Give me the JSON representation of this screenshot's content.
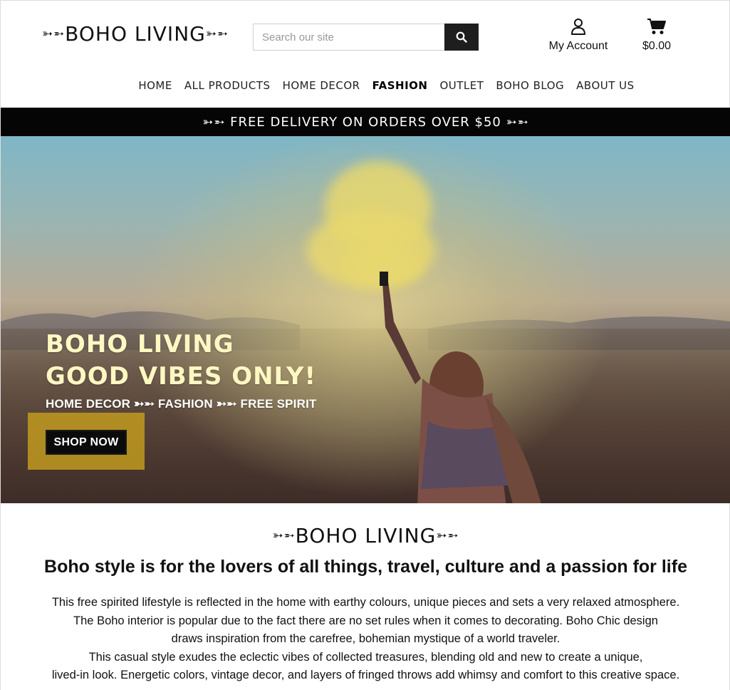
{
  "header": {
    "logo_prefix": "➳➵",
    "logo_text": "BOHO LIVING",
    "logo_suffix": "➳➵",
    "search_placeholder": "Search our site",
    "account_label": "My Account",
    "cart_total": "$0.00",
    "icons": {
      "search": "search-icon",
      "account": "user-icon",
      "cart": "cart-icon"
    }
  },
  "nav": {
    "items": [
      {
        "label": "HOME"
      },
      {
        "label": "ALL PRODUCTS"
      },
      {
        "label": "HOME DECOR"
      },
      {
        "label": "FASHION"
      },
      {
        "label": "OUTLET"
      },
      {
        "label": "BOHO BLOG"
      },
      {
        "label": "ABOUT US"
      }
    ],
    "active_index": 3
  },
  "promo": {
    "text": "➳➵ FREE DELIVERY ON ORDERS OVER $50 ➳➵"
  },
  "hero": {
    "title_line1": "BOHO LIVING",
    "title_line2": "GOOD VIBES ONLY!",
    "subtitle": "HOME DECOR ➳➵ FASHION ➳➵ FREE SPIRIT",
    "cta_label": "SHOP NOW",
    "accent_color": "#c49e1e"
  },
  "intro": {
    "logo_prefix": "➳➵",
    "logo_text": "BOHO LIVING",
    "logo_suffix": "➳➵",
    "heading": "Boho style is for the lovers of all things, travel, culture and a passion for life",
    "lines": [
      "This free spirited lifestyle is reflected in the home with earthy colours, unique pieces and sets a very relaxed atmosphere.",
      "The Boho interior is popular due to the fact there are no set rules when it comes to decorating. Boho Chic design",
      "draws inspiration from the carefree, bohemian mystique of a world traveler.",
      "This casual style exudes the eclectic vibes of collected treasures, blending old and new to create a unique,",
      "lived-in look. Energetic colors, vintage decor, and layers of fringed throws add whimsy and comfort to this creative space."
    ]
  }
}
